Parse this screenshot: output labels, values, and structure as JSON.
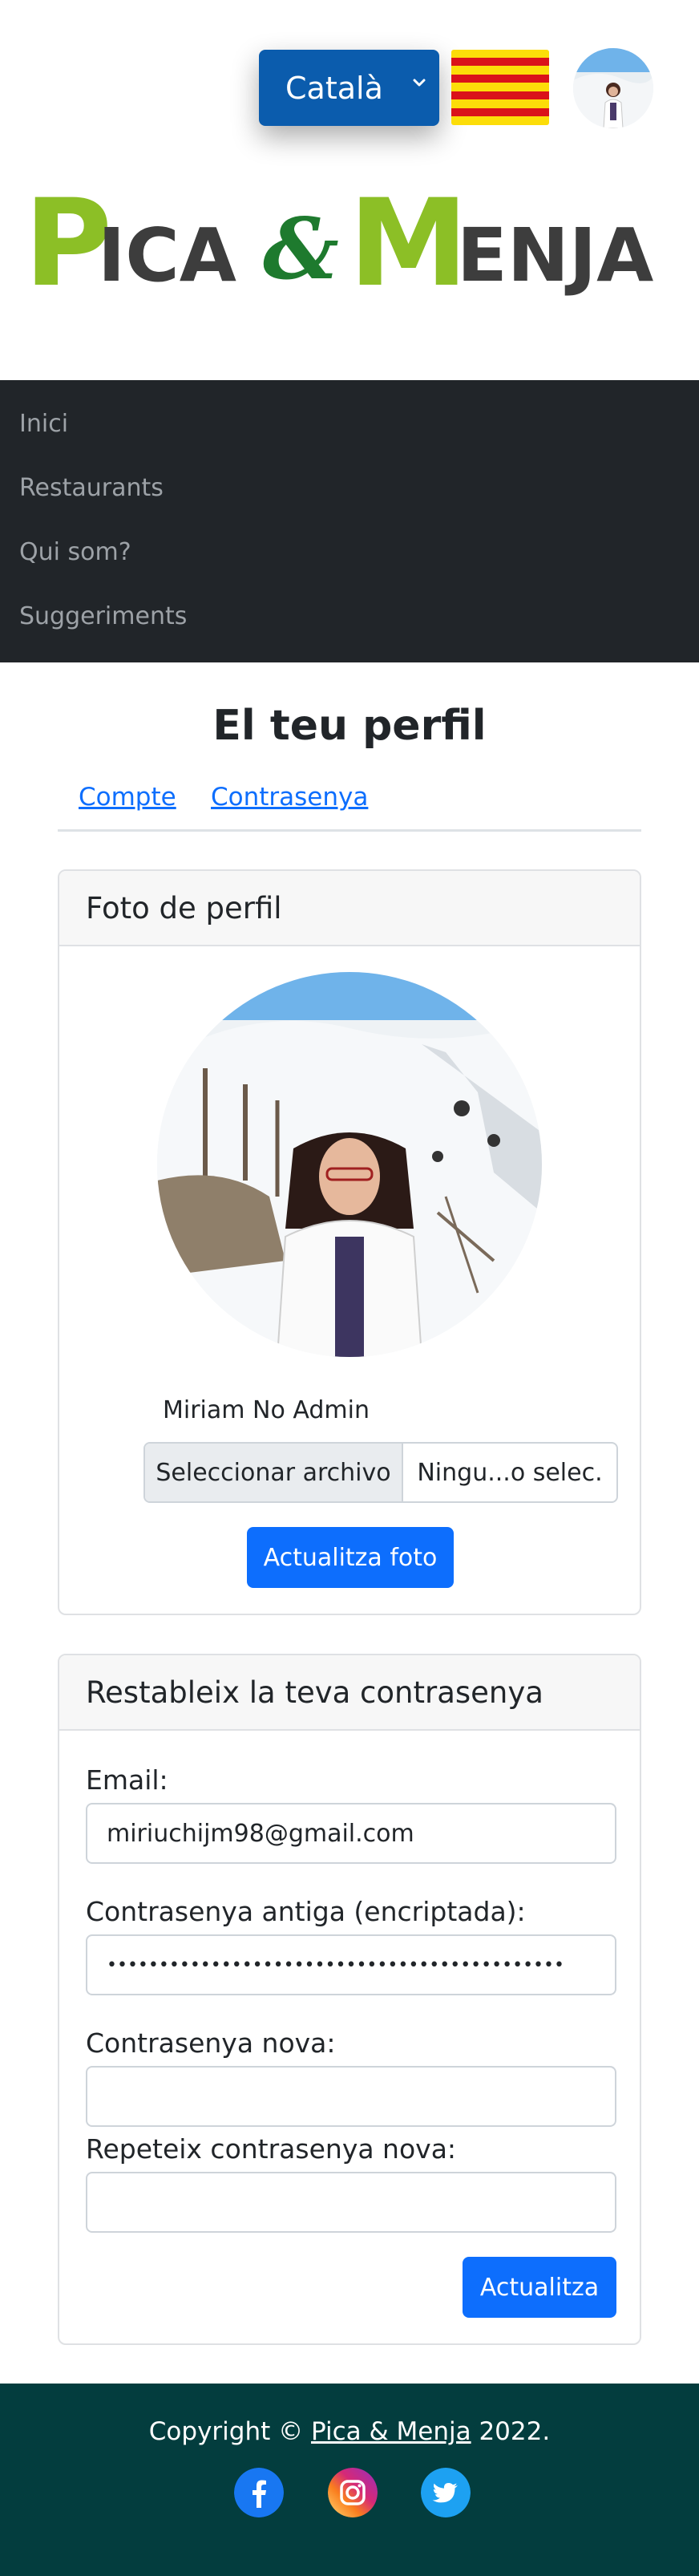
{
  "header": {
    "language_selected": "Català",
    "logo_text": "Pica & Menja"
  },
  "nav": {
    "items": [
      {
        "label": "Inici"
      },
      {
        "label": "Restaurants"
      },
      {
        "label": "Qui som?"
      },
      {
        "label": "Suggeriments"
      }
    ]
  },
  "main": {
    "title": "El teu perfil",
    "tabs": [
      {
        "label": "Compte"
      },
      {
        "label": "Contrasenya"
      }
    ]
  },
  "photo_card": {
    "header": "Foto de perfil",
    "user_name": "Miriam No Admin",
    "file_button": "Seleccionar archivo",
    "file_name": "Ningu...o selec.",
    "submit": "Actualitza foto"
  },
  "password_card": {
    "header": "Restableix la teva contrasenya",
    "email_label": "Email:",
    "email_value": "miriuchijm98@gmail.com",
    "old_password_label": "Contrasenya antiga (encriptada):",
    "old_password_value": "••••••••••••••••••••••••••••••••••••••••••••",
    "new_password_label": "Contrasenya nova:",
    "new_password_value": "",
    "repeat_password_label": "Repeteix contrasenya nova:",
    "repeat_password_value": "",
    "submit": "Actualitza"
  },
  "footer": {
    "copyright_prefix": "Copyright © ",
    "copyright_link": "Pica & Menja",
    "copyright_suffix": " 2022."
  },
  "colors": {
    "primary": "#0d6efd",
    "nav_bg": "#212529",
    "footer_bg": "#033d3e",
    "logo_green": "#8cbf26",
    "logo_dark_green": "#1e7a2e",
    "logo_gray": "#3d3d3d"
  }
}
